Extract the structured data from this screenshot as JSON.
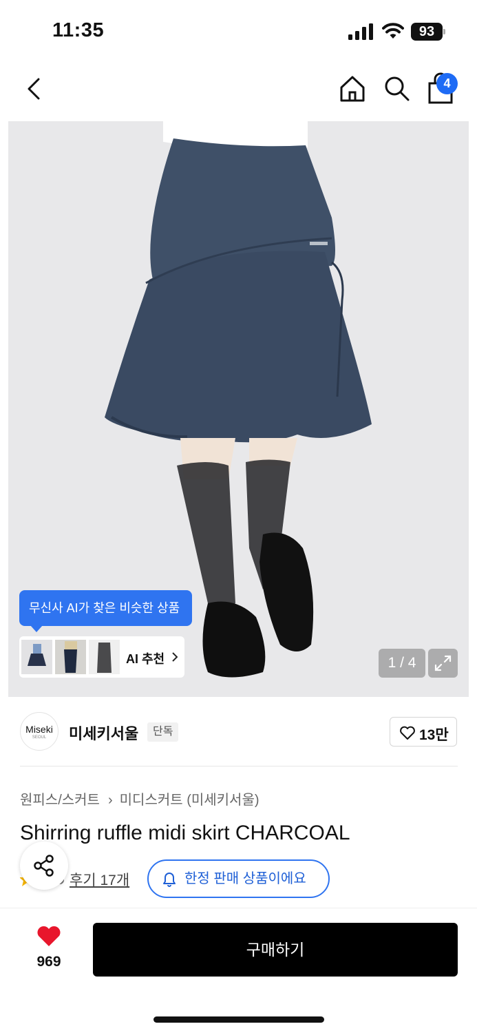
{
  "status_bar": {
    "time": "11:35",
    "battery": "93"
  },
  "header": {
    "cart_count": "4"
  },
  "gallery": {
    "ai_tooltip": "무신사 AI가 찾은 비슷한 상품",
    "ai_button": "AI 추천",
    "counter": "1 / 4"
  },
  "brand": {
    "logo_text": "Miseki",
    "logo_sub": "SEOUL",
    "name": "미세키서울",
    "badge": "단독",
    "likes": "13만"
  },
  "product": {
    "breadcrumb": [
      "원피스/스커트",
      "미디스커트 (미세키서울)"
    ],
    "title": "Shirring ruffle midi skirt CHARCOAL",
    "reviews": "후기 17개",
    "limited_badge": "한정 판매 상품이에요"
  },
  "bottom_bar": {
    "wish_count": "969",
    "buy_label": "구매하기"
  },
  "colors": {
    "accent": "#2f74f0",
    "heart": "#e8162c",
    "buy": "#000000"
  }
}
